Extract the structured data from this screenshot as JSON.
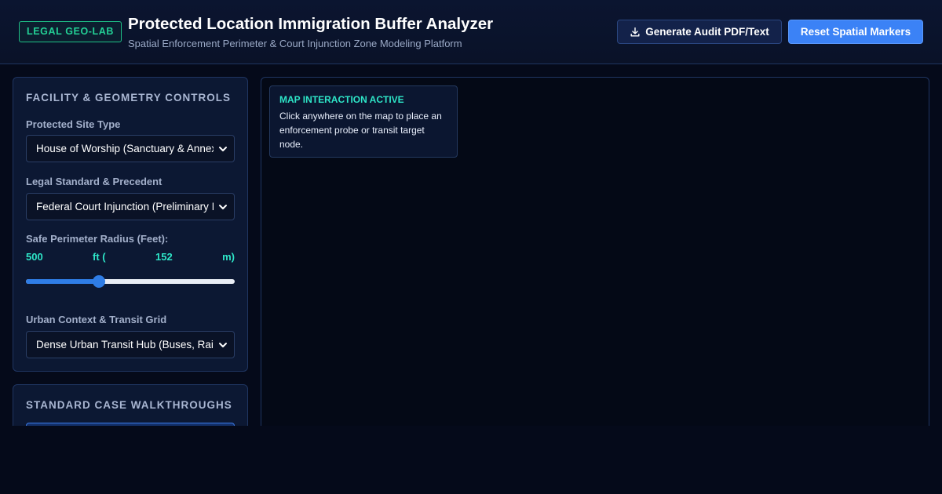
{
  "header": {
    "badge": "LEGAL GEO-LAB",
    "title": "Protected Location Immigration Buffer Analyzer",
    "subtitle": "Spatial Enforcement Perimeter & Court Injunction Zone Modeling Platform",
    "audit_button": "Generate Audit PDF/Text",
    "reset_button": "Reset Spatial Markers",
    "audit_icon": "download-icon"
  },
  "controls": {
    "title": "FACILITY & GEOMETRY CONTROLS",
    "site_type_label": "Protected Site Type",
    "site_type_value": "House of Worship (Sanctuary & Annex)",
    "legal_label": "Legal Standard & Precedent",
    "legal_value": "Federal Court Injunction (Preliminary Injunction)",
    "radius_label": "Safe Perimeter Radius (Feet):",
    "radius_ft": "500",
    "radius_ft_unit": "ft (",
    "radius_m": "152",
    "radius_m_unit": "m)",
    "radius_fraction": 0.35,
    "urban_label": "Urban Context & Transit Grid",
    "urban_value": "Dense Urban Transit Hub (Buses, Rail)"
  },
  "walkthroughs": {
    "title": "STANDARD CASE WALKTHROUGHS"
  },
  "map": {
    "tip_title": "MAP INTERACTION ACTIVE",
    "tip_body": "Click anywhere on the map to place an enforcement probe or transit target node."
  },
  "colors": {
    "accent_teal": "#2ee6c8",
    "badge_green": "#23d095",
    "primary_blue": "#3b82f6"
  }
}
